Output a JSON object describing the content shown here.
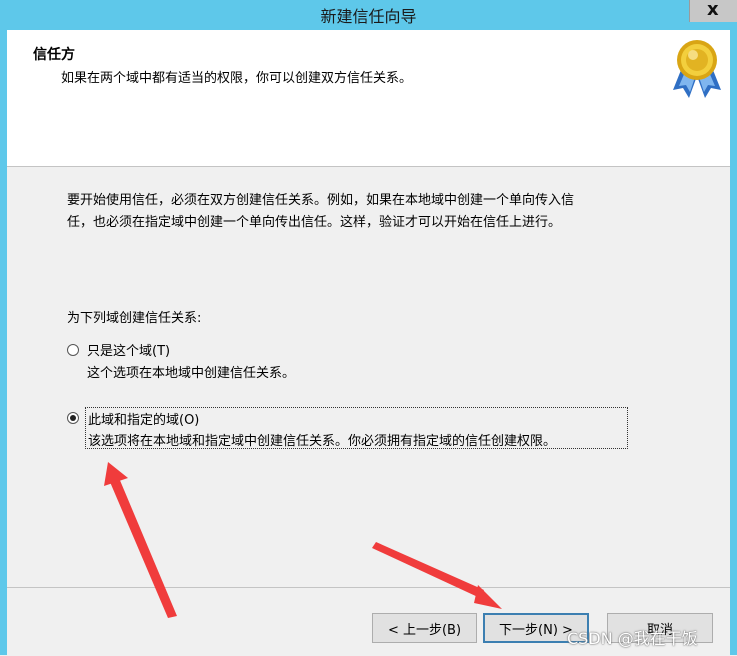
{
  "window": {
    "title": "新建信任向导",
    "close_label": "x"
  },
  "header": {
    "title": "信任方",
    "subtitle": "如果在两个域中都有适当的权限，你可以创建双方信任关系。",
    "icon": "certificate-medal-icon"
  },
  "body": {
    "intro_line1": "要开始使用信任，必须在双方创建信任关系。例如，如果在本地域中创建一个单向传入信",
    "intro_line2": "任，也必须在指定域中创建一个单向传出信任。这样，验证才可以开始在信任上进行。",
    "prompt": "为下列域创建信任关系:",
    "options": [
      {
        "label": "只是这个域(T)",
        "description": "这个选项在本地域中创建信任关系。",
        "selected": false
      },
      {
        "label": "此域和指定的域(O)",
        "description": "该选项将在本地域和指定域中创建信任关系。你必须拥有指定域的信任创建权限。",
        "selected": true
      }
    ]
  },
  "footer": {
    "back_label": "< 上一步(B)",
    "next_label": "下一步(N) >",
    "cancel_label": "取消"
  },
  "watermark": "CSDN @我在干饭",
  "colors": {
    "titlebar": "#5ec8ea",
    "annotation_arrow": "#f03c3c",
    "default_button_border": "#3c7fb1"
  }
}
